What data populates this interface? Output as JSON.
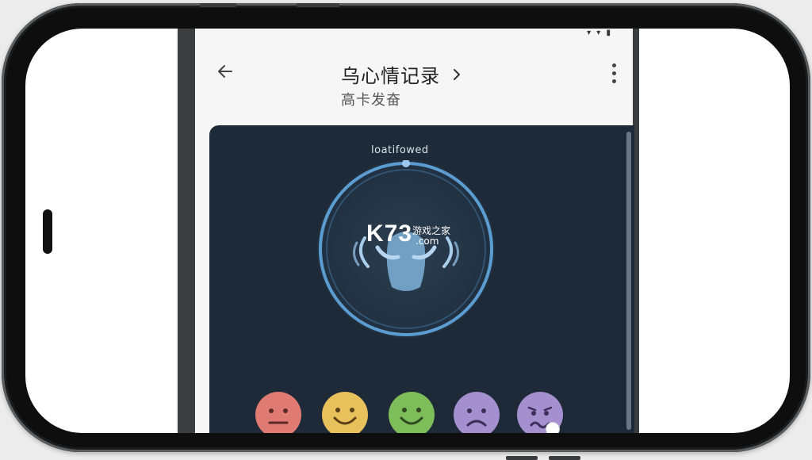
{
  "header": {
    "title": "乌心情记录",
    "subtitle": "高卡发奋",
    "back_icon": "arrow-left-icon",
    "more_icon": "more-vert-icon"
  },
  "card": {
    "orb_label": "loatifowed"
  },
  "watermark": {
    "logo": "K73",
    "text": "游戏之家",
    "domain": ".com"
  },
  "moods": [
    {
      "name": "neutral",
      "color": "#e07b74"
    },
    {
      "name": "happy",
      "color": "#e9c15c"
    },
    {
      "name": "happy",
      "color": "#7dbe5a"
    },
    {
      "name": "sad",
      "color": "#a48fcf"
    },
    {
      "name": "worried",
      "color": "#a48fcf"
    }
  ],
  "colors": {
    "card_bg": "#1e2a37",
    "ring": "#5fa3d8"
  }
}
